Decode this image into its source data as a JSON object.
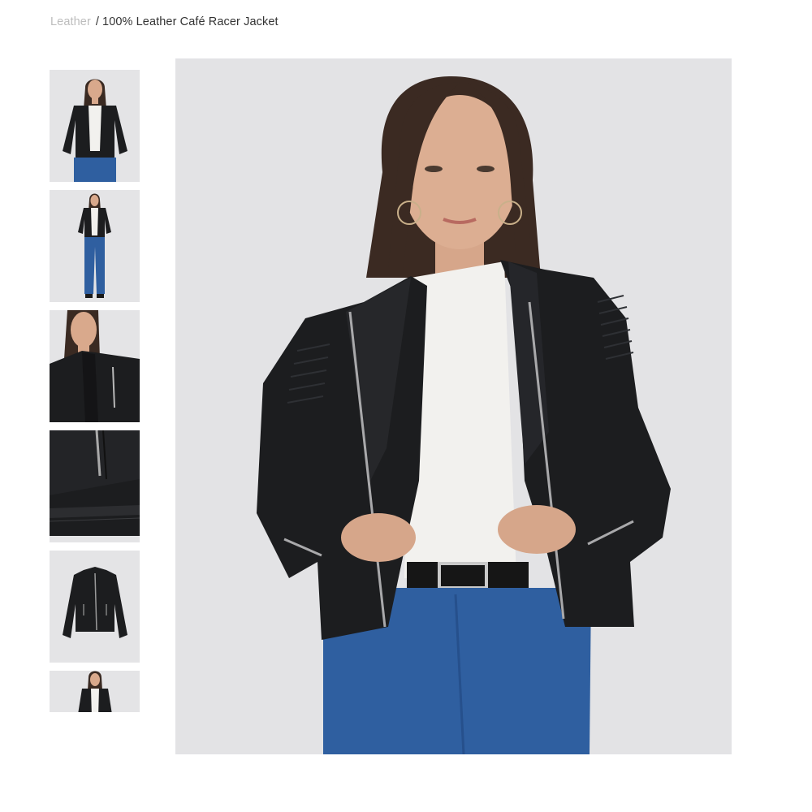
{
  "breadcrumb": {
    "parent": "Leather",
    "separator": "/",
    "current": "100% Leather Café Racer Jacket"
  },
  "gallery": {
    "thumbnails": [
      {
        "view": "front-full-body"
      },
      {
        "view": "front-full-length"
      },
      {
        "view": "collar-closeup"
      },
      {
        "view": "pocket-detail"
      },
      {
        "view": "flat-lay"
      },
      {
        "view": "front-full-body-partial"
      }
    ],
    "main_view": "front-model"
  },
  "colors": {
    "image_background": "#e3e3e5",
    "jacket": "#1c1d1f",
    "denim": "#2f5fa0",
    "shirt": "#f2f1ee",
    "breadcrumb_muted": "#bdbdbd"
  }
}
